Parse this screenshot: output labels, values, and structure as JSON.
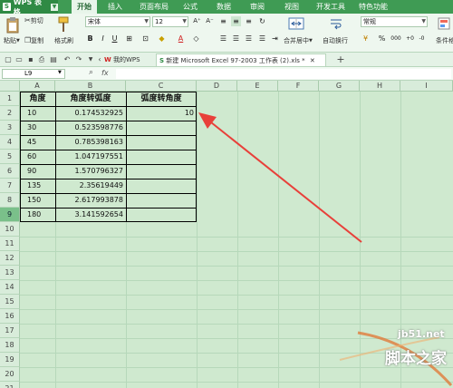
{
  "app": {
    "name": "WPS 表格"
  },
  "menu_tabs": [
    "开始",
    "插入",
    "页面布局",
    "公式",
    "数据",
    "审阅",
    "视图",
    "开发工具",
    "特色功能"
  ],
  "clipboard": {
    "cut": "剪切",
    "paste": "粘贴",
    "copy": "复制",
    "format_painter": "格式刷"
  },
  "font": {
    "name": "宋体",
    "size": "12"
  },
  "alignment": {
    "merge": "合并居中",
    "wrap": "自动换行"
  },
  "number": {
    "format": "常规",
    "percent": "%",
    "comma": "000"
  },
  "conditional": "条件格",
  "format_buttons": {
    "bold": "B",
    "italic": "I",
    "underline": "U",
    "font_color": "A",
    "grow": "A⁺",
    "shrink": "A⁻"
  },
  "doc_tabs": [
    {
      "label": "我的WPS"
    },
    {
      "label": "新建 Microsoft Excel 97-2003 工作表 (2).xls *"
    }
  ],
  "formula_bar": {
    "cell_ref": "L9",
    "fx": "fx",
    "value": ""
  },
  "columns": [
    "A",
    "B",
    "C",
    "D",
    "E",
    "F",
    "G",
    "H",
    "I"
  ],
  "rows": [
    "1",
    "2",
    "3",
    "4",
    "5",
    "6",
    "7",
    "8",
    "9",
    "10",
    "11",
    "12",
    "13",
    "14",
    "15",
    "16",
    "17",
    "18",
    "19",
    "20",
    "21"
  ],
  "table": {
    "headers": [
      "角度",
      "角度转弧度",
      "弧度转角度"
    ],
    "rows": [
      [
        "10",
        "0.174532925",
        "10"
      ],
      [
        "30",
        "0.523598776",
        ""
      ],
      [
        "45",
        "0.785398163",
        ""
      ],
      [
        "60",
        "1.047197551",
        ""
      ],
      [
        "90",
        "1.570796327",
        ""
      ],
      [
        "135",
        "2.35619449",
        ""
      ],
      [
        "150",
        "2.617993878",
        ""
      ],
      [
        "180",
        "3.141592654",
        ""
      ]
    ]
  },
  "watermark": {
    "site": "jb51.net",
    "name": "脚本之家"
  },
  "colors": {
    "accent": "#3f9b54",
    "grid_bg": "#cfe9cf",
    "arrow": "#e8403a"
  }
}
